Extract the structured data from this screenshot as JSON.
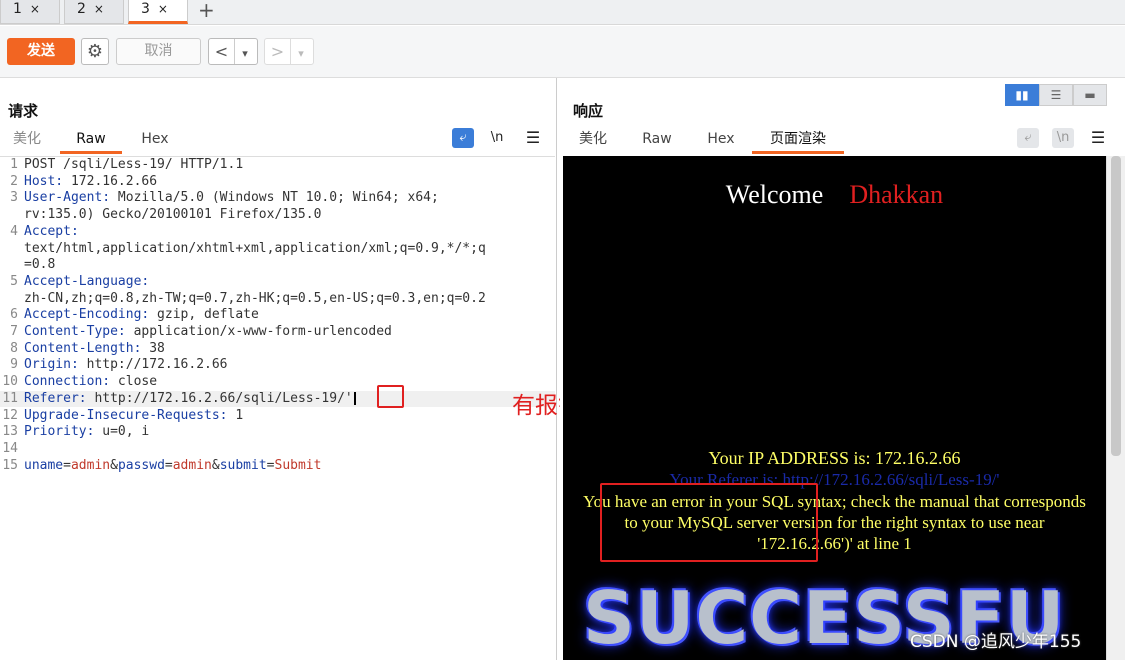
{
  "tabs": [
    {
      "label": "1",
      "close": "×"
    },
    {
      "label": "2",
      "close": "×"
    },
    {
      "label": "3",
      "close": "×",
      "active": true
    }
  ],
  "new_tab_label": "+",
  "toolbar": {
    "send_label": "发送",
    "cancel_label": "取消",
    "back_label": "<",
    "back_menu_label": "▾",
    "forward_label": ">",
    "forward_menu_label": "▾"
  },
  "request": {
    "title": "请求",
    "tabs": [
      "美化",
      "Raw",
      "Hex"
    ],
    "active_tab": "Raw",
    "wrap_icon": "wrap-icon",
    "newline_toggle": "\\n",
    "menu_label": "☰",
    "lines": [
      {
        "n": "1",
        "key": "",
        "value": "POST /sqli/Less-19/ HTTP/1.1"
      },
      {
        "n": "2",
        "key": "Host:",
        "value": " 172.16.2.66"
      },
      {
        "n": "3",
        "key": "User-Agent:",
        "value": " Mozilla/5.0 (Windows NT 10.0; Win64; x64;"
      },
      {
        "n": "",
        "key": "",
        "value": "rv:135.0) Gecko/20100101 Firefox/135.0"
      },
      {
        "n": "4",
        "key": "Accept:",
        "value": ""
      },
      {
        "n": "",
        "key": "",
        "value": "text/html,application/xhtml+xml,application/xml;q=0.9,*/*;q"
      },
      {
        "n": "",
        "key": "",
        "value": "=0.8"
      },
      {
        "n": "5",
        "key": "Accept-Language:",
        "value": ""
      },
      {
        "n": "",
        "key": "",
        "value": "zh-CN,zh;q=0.8,zh-TW;q=0.7,zh-HK;q=0.5,en-US;q=0.3,en;q=0.2"
      },
      {
        "n": "6",
        "key": "Accept-Encoding:",
        "value": " gzip, deflate"
      },
      {
        "n": "7",
        "key": "Content-Type:",
        "value": " application/x-www-form-urlencoded"
      },
      {
        "n": "8",
        "key": "Content-Length:",
        "value": " 38"
      },
      {
        "n": "9",
        "key": "Origin:",
        "value": " http://172.16.2.66"
      },
      {
        "n": "10",
        "key": "Connection:",
        "value": " close"
      },
      {
        "n": "11",
        "key": "Referer:",
        "value": " http://172.16.2.66/sqli/Less-19/'",
        "highlight": true,
        "cursor": true
      },
      {
        "n": "12",
        "key": "Upgrade-Insecure-Requests:",
        "value": " 1"
      },
      {
        "n": "13",
        "key": "Priority:",
        "value": " u=0, i"
      },
      {
        "n": "14",
        "key": "",
        "value": ""
      },
      {
        "n": "15",
        "key": "",
        "value": "",
        "params": true
      }
    ],
    "body_params": [
      {
        "k": "uname",
        "v": "admin"
      },
      {
        "k": "passwd",
        "v": "admin"
      },
      {
        "k": "submit",
        "v": "Submit"
      }
    ]
  },
  "annotation": "有报错显示    闭合失败",
  "response": {
    "title": "响应",
    "tabs": [
      "美化",
      "Raw",
      "Hex",
      "页面渲染"
    ],
    "active_tab": "页面渲染",
    "menu_label": "☰",
    "newline_toggle": "\\n",
    "rendered": {
      "welcome": "Welcome",
      "name": "Dhakkan",
      "ip_line": "Your IP ADDRESS is: 172.16.2.66",
      "referer_line": "Your Referer is: http://172.16.2.66/sqli/Less-19/'",
      "error_line": "You have an error in your SQL syntax; check the manual that corresponds to your MySQL server version for the right syntax to use near '172.16.2.66')' at line 1",
      "banner": "SUCCESSFU"
    }
  },
  "watermark": "CSDN @追风少年155",
  "colors": {
    "accent": "#f26522",
    "error_text": "#ffff66",
    "annotation": "#e02020"
  }
}
